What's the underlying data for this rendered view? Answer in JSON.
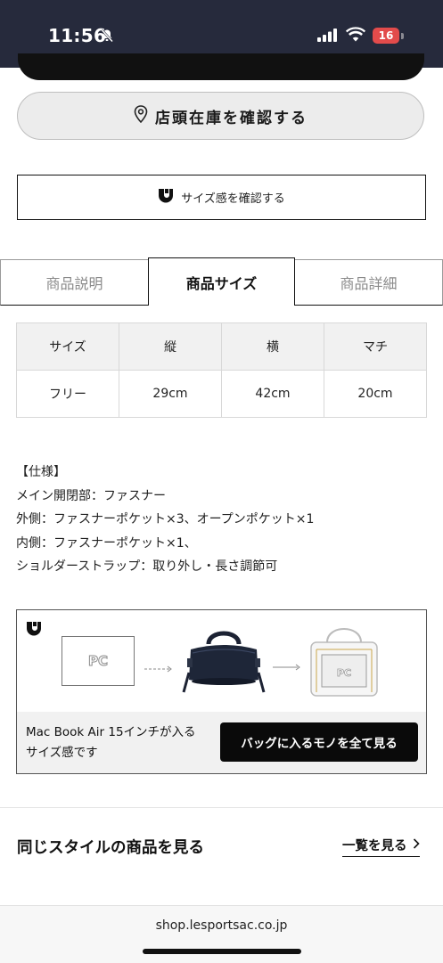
{
  "status_bar": {
    "time": "11:56",
    "battery": "16",
    "battery_color": "#e24b4b",
    "background": "#262a3c"
  },
  "actions": {
    "store_stock_label": "店頭在庫を確認する",
    "size_check_label": "サイズ感を確認する"
  },
  "tabs": [
    {
      "label": "商品説明",
      "active": false
    },
    {
      "label": "商品サイズ",
      "active": true
    },
    {
      "label": "商品詳細",
      "active": false
    }
  ],
  "size_table": {
    "headers": [
      "サイズ",
      "縦",
      "横",
      "マチ"
    ],
    "rows": [
      [
        "フリー",
        "29cm",
        "42cm",
        "20cm"
      ]
    ]
  },
  "specs": [
    "【仕様】",
    "メイン開閉部：ファスナー",
    "外側：ファスナーポケット×3、オープンポケット×1",
    "内側：ファスナーポケット×1、",
    "ショルダーストラップ：取り外し・長さ調節可"
  ],
  "banner": {
    "pc_label": "PC",
    "fit_text_line1": "Mac Book Air 15インチが入る",
    "fit_text_line2": "サイズ感です",
    "button_label": "バッグに入るモノを全て見る"
  },
  "related": {
    "title": "同じスタイルの商品を見る",
    "view_all_label": "一覧を見る"
  },
  "browser": {
    "url": "shop.lesportsac.co.jp"
  }
}
